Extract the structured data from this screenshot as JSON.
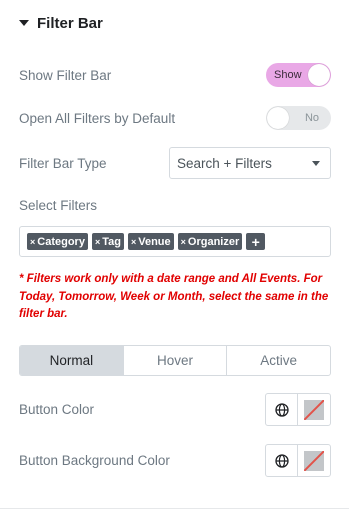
{
  "section": {
    "title": "Filter Bar"
  },
  "show_filter_bar": {
    "label": "Show Filter Bar",
    "toggle_text": "Show",
    "state": true
  },
  "open_all_filters": {
    "label": "Open All Filters by Default",
    "toggle_text": "No",
    "state": false
  },
  "filter_bar_type": {
    "label": "Filter Bar Type",
    "value": "Search + Filters"
  },
  "select_filters": {
    "label": "Select Filters",
    "tags": [
      "Category",
      "Tag",
      "Venue",
      "Organizer"
    ],
    "remove_glyph": "×",
    "add_glyph": "+"
  },
  "note": "* Filters work only with a date range and All Events. For Today, Tomorrow, Week or Month, select the same in the filter bar.",
  "tabs": {
    "items": [
      "Normal",
      "Hover",
      "Active"
    ],
    "active": "Normal"
  },
  "button_color": {
    "label": "Button Color"
  },
  "button_bg_color": {
    "label": "Button Background Color"
  },
  "colors": {
    "accent": "#e9a8e6",
    "note": "#e10000",
    "active_tab": "#d5dadf"
  },
  "icons": {
    "globe": "globe-icon",
    "clear_swatch": "no-color-swatch-icon",
    "caret": "caret-down-icon"
  }
}
